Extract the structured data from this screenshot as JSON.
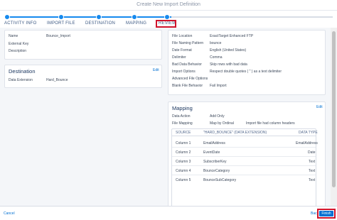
{
  "dialog": {
    "title": "Create New Import Definition"
  },
  "steps": [
    {
      "label": "ACTIVITY INFO"
    },
    {
      "label": "IMPORT FILE"
    },
    {
      "label": "DESTINATION"
    },
    {
      "label": "MAPPING"
    },
    {
      "label": "REVIEW"
    }
  ],
  "summary": {
    "name_label": "Name",
    "name_value": "Bounce_Import",
    "external_key_label": "External Key",
    "description_label": "Description"
  },
  "destination": {
    "title": "Destination",
    "edit": "Edit",
    "de_label": "Data Extension",
    "de_value": "Hard_Bounce"
  },
  "import_file": {
    "rows": [
      {
        "label": "File Location",
        "value": "ExactTarget Enhanced FTP"
      },
      {
        "label": "File Naming Pattern",
        "value": "bounce"
      },
      {
        "label": "Date Format",
        "value": "English (United States)"
      },
      {
        "label": "Delimiter",
        "value": "Comma"
      },
      {
        "label": "Bad Data Behavior",
        "value": "Skip rows with bad data"
      },
      {
        "label": "Import Options",
        "value": "Respect double quotes ( \" ) as a text delimiter"
      },
      {
        "label": "Advanced File Options",
        "value": ""
      },
      {
        "label": "Blank File Behavior",
        "value": "Fail Import"
      }
    ]
  },
  "mapping": {
    "title": "Mapping",
    "edit": "Edit",
    "data_action_label": "Data Action",
    "data_action_value": "Add Only",
    "file_mapping_label": "File Mapping",
    "file_mapping_value": "Map by Ordinal",
    "header_note": "Import file had column headers",
    "columns": {
      "source": "SOURCE",
      "target": "\"HARD_BOUNCE\" (DATA EXTENSION)",
      "type": "DATA TYPE"
    },
    "rows": [
      {
        "source": "Column 1",
        "target": "EmailAddress",
        "type": "EmailAddress"
      },
      {
        "source": "Column 2",
        "target": "EventDate",
        "type": "Date"
      },
      {
        "source": "Column 3",
        "target": "SubscriberKey",
        "type": "Text"
      },
      {
        "source": "Column 4",
        "target": "BounceCategory",
        "type": "Text"
      },
      {
        "source": "Column 5",
        "target": "BounceSubCategory",
        "type": "Text"
      }
    ]
  },
  "footer": {
    "cancel": "Cancel",
    "back": "Back",
    "finish": "Finish"
  },
  "colors": {
    "accent": "#0070d2",
    "highlight": "#d0142c",
    "progress": "#1589ee"
  }
}
